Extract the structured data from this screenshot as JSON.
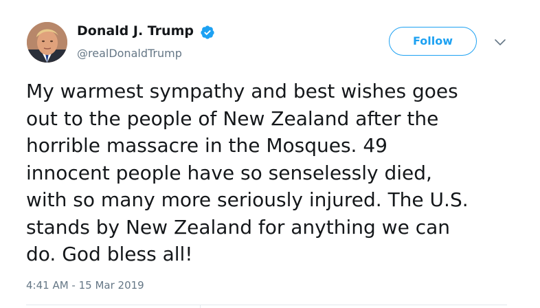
{
  "tweet": {
    "author": {
      "name": "Donald J. Trump",
      "handle": "@realDonaldTrump",
      "verified": true,
      "avatar_icon": "profile-photo"
    },
    "follow_label": "Follow",
    "more_icon": "chevron-down-icon",
    "text_lines": [
      "My warmest sympathy and best wishes goes",
      "out to the people of New Zealand after the",
      "horrible massacre in the Mosques. 49",
      "innocent people have so senselessly died,",
      "with so many more seriously injured. The U.S.",
      "stands by New Zealand for anything we can",
      "do. God bless all!"
    ],
    "timestamp": "4:41 AM - 15 Mar 2019"
  },
  "colors": {
    "accent": "#1da1f2",
    "text_primary": "#14171a",
    "text_secondary": "#657786",
    "divider": "#e1e8ed"
  }
}
